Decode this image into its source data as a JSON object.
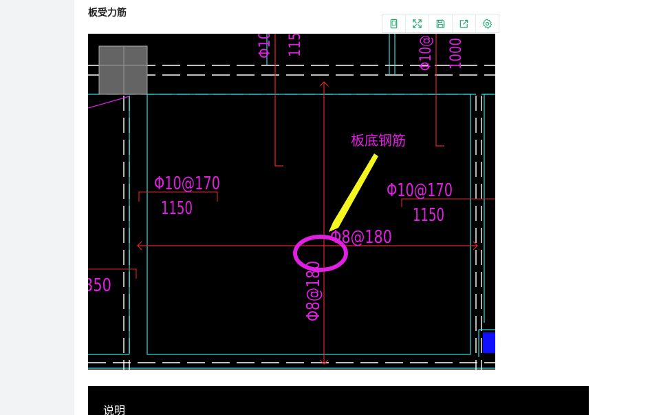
{
  "page": {
    "section_title": "板受力筋"
  },
  "toolbar": {
    "buttons": [
      {
        "icon": "phone-icon"
      },
      {
        "icon": "fullscreen-icon"
      },
      {
        "icon": "save-icon"
      },
      {
        "icon": "share-icon"
      },
      {
        "icon": "settings-icon"
      }
    ],
    "icon_color": "#22a96e"
  },
  "drawing": {
    "annotation": "板底钢筋",
    "rebar_top_left_a": "Φ10@170",
    "rebar_top_left_b": "1150",
    "rebar_right_a": "Φ10@170",
    "rebar_right_b": "1150",
    "rebar_center_h": "Φ8@180",
    "rebar_center_v": "Φ8@180",
    "left_partial": "350",
    "top_left_mark_a": "Φ10",
    "top_left_mark_b": "115",
    "top_right_mark_a": "Φ10@",
    "top_right_mark_b": "1000",
    "colors": {
      "background": "#000000",
      "magenta": "#e020e0",
      "red": "#e0262a",
      "cyan": "#30e0e0",
      "white": "#ffffff",
      "yellow": "#f5f520",
      "blue": "#1010ff"
    }
  },
  "bottom": {
    "label": "说明"
  }
}
